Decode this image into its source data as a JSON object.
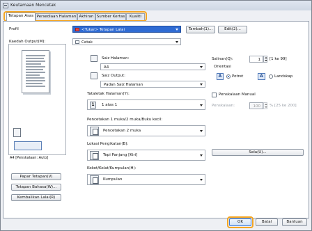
{
  "window": {
    "title": "Keutamaan Mencetak"
  },
  "tabs": [
    {
      "label": "Tetapan Asas"
    },
    {
      "label": "Persediaan Halaman"
    },
    {
      "label": "Akhiran"
    },
    {
      "label": "Sumber Kertas"
    },
    {
      "label": "Kualiti"
    }
  ],
  "profile": {
    "label": "Profil",
    "value": "<Tukar> Tetapan Lalai",
    "add_button": "Tambah(1)...",
    "edit_button": "Edit(2)..."
  },
  "output_method": {
    "label": "Kaedah Output(M):",
    "value": "Cetak"
  },
  "preview": {
    "caption": "A4 [Penskalaan: Auto]"
  },
  "left_buttons": {
    "view_settings": "Papar Tetapan(V)",
    "language_settings": "Tetapan Bahasa(W)...",
    "restore_defaults": "Kembalikan Lalai(R)"
  },
  "page_size": {
    "label": "Saiz Halaman:",
    "value": "A4"
  },
  "output_size": {
    "label": "Saiz Output:",
    "value": "Padan Saiz Halaman"
  },
  "copies": {
    "label": "Salinan(Q):",
    "value": "1",
    "range": "[1 ke 99]"
  },
  "orientation": {
    "label": "Orientasi",
    "portrait": "Potret",
    "landscape": "Landskap",
    "selected": "portrait"
  },
  "page_layout": {
    "label": "Tataletak Halaman(Y):",
    "value": "1 atas 1",
    "icon_text": "1"
  },
  "manual_scaling": {
    "label": "Penskalaan Manual",
    "checked": false
  },
  "scaling": {
    "label": "Penskalaan:",
    "value": "100",
    "range": "% [25 ke 200]"
  },
  "duplex": {
    "label": "Pencetakan 1 muka/2 muka/Buku kecil:",
    "value": "Pencetakan 2 muka"
  },
  "binding": {
    "label": "Lokasi Pengikatan(B):",
    "value": "Tepi Panjang [Kiri]"
  },
  "gutter_button": "Sela(U)...",
  "finishing": {
    "label": "Kokot/Kolat/Kumpulan(H):",
    "value": "Kumpulan"
  },
  "footer": {
    "ok": "OK",
    "cancel": "Batal",
    "help": "Bantuan"
  }
}
